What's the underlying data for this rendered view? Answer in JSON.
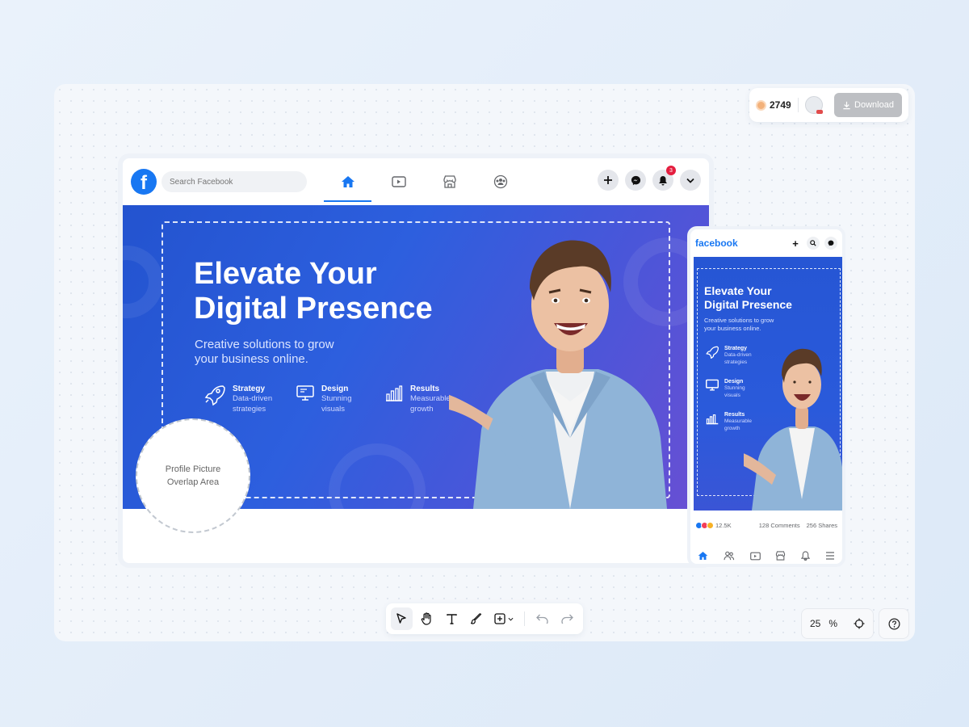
{
  "credits": {
    "count": "2749",
    "download_label": "Download"
  },
  "desktop": {
    "search_placeholder": "Search Facebook",
    "nav": [
      "home-icon",
      "video-icon",
      "marketplace-icon",
      "groups-icon"
    ],
    "notification_count": "3",
    "cover": {
      "headline_line1": "Elevate Your",
      "headline_line2": "Digital Presence",
      "subline_line1": "Creative solutions to grow",
      "subline_line2": "your business online.",
      "features": [
        {
          "icon": "rocket-icon",
          "title": "Strategy",
          "sub1": "Data-driven",
          "sub2": "strategies"
        },
        {
          "icon": "monitor-icon",
          "title": "Design",
          "sub1": "Stunning",
          "sub2": "visuals"
        },
        {
          "icon": "bar-chart-icon",
          "title": "Results",
          "sub1": "Measurable",
          "sub2": "growth"
        }
      ]
    },
    "profile_zone": {
      "line1": "Profile Picture",
      "line2": "Overlap Area"
    }
  },
  "mobile": {
    "logo": "facebook",
    "headline_line1": "Elevate Your",
    "headline_line2": "Digital Presence",
    "subline_line1": "Creative solutions to grow",
    "subline_line2": "your business online.",
    "features": [
      {
        "title": "Strategy",
        "sub1": "Data-driven",
        "sub2": "strategies"
      },
      {
        "title": "Design",
        "sub1": "Stunning",
        "sub2": "visuals"
      },
      {
        "title": "Results",
        "sub1": "Measurable",
        "sub2": "growth"
      }
    ],
    "reactions": "12.5K",
    "comments": "128 Comments",
    "shares": "256 Shares"
  },
  "toolbar": {
    "tools": [
      "select-tool",
      "hand-tool",
      "text-tool",
      "brush-tool",
      "add-tool",
      "undo",
      "redo"
    ]
  },
  "zoom": {
    "value": "25",
    "unit": "%"
  },
  "colors": {
    "facebook_blue": "#1877f2",
    "cover_blue": "#2353cf",
    "cover_purple": "#6a4fd3",
    "badge_red": "#e41e3f"
  }
}
